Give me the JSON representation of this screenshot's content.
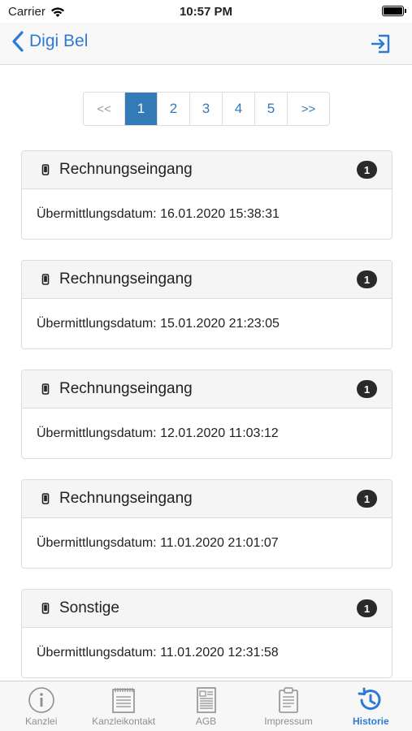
{
  "status_bar": {
    "carrier": "Carrier",
    "time": "10:57 PM"
  },
  "nav": {
    "back_label": "Digi Bel",
    "back_icon": "chevron-left-icon",
    "action_icon": "logout-icon",
    "accent": "#2d7ad6"
  },
  "pagination": {
    "first": "<<",
    "pages": [
      "1",
      "2",
      "3",
      "4",
      "5"
    ],
    "active_page": "1",
    "next": ">>"
  },
  "entries": [
    {
      "title": "Rechnungseingang",
      "badge": "1",
      "date": "Übermittlungsdatum: 16.01.2020 15:38:31"
    },
    {
      "title": "Rechnungseingang",
      "badge": "1",
      "date": "Übermittlungsdatum: 15.01.2020 21:23:05"
    },
    {
      "title": "Rechnungseingang",
      "badge": "1",
      "date": "Übermittlungsdatum: 12.01.2020 11:03:12"
    },
    {
      "title": "Rechnungseingang",
      "badge": "1",
      "date": "Übermittlungsdatum: 11.01.2020 21:01:07"
    },
    {
      "title": "Sonstige",
      "badge": "1",
      "date": "Übermittlungsdatum: 11.01.2020 12:31:58"
    }
  ],
  "tabs": [
    {
      "label": "Kanzlei",
      "icon": "info-icon",
      "active": false
    },
    {
      "label": "Kanzleikontakt",
      "icon": "notepad-icon",
      "active": false
    },
    {
      "label": "AGB",
      "icon": "document-icon",
      "active": false
    },
    {
      "label": "Impressum",
      "icon": "clipboard-icon",
      "active": false
    },
    {
      "label": "Historie",
      "icon": "history-icon",
      "active": true
    }
  ]
}
